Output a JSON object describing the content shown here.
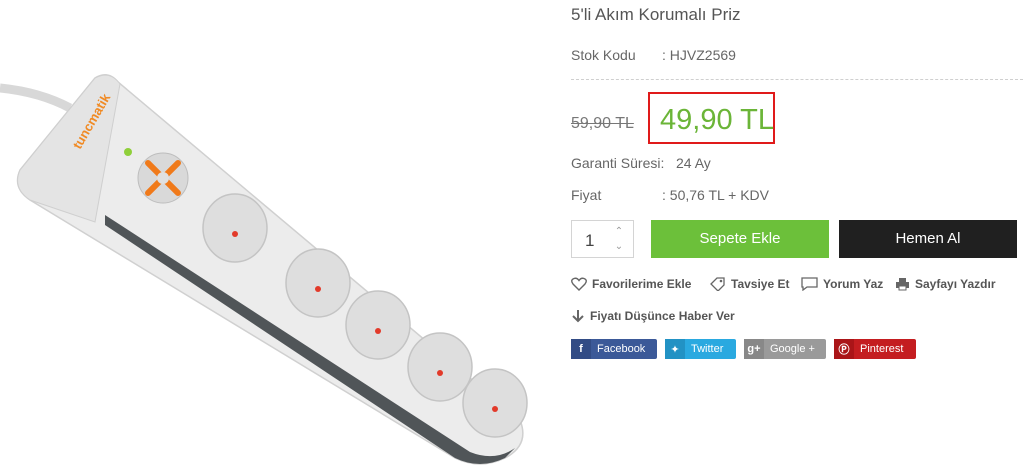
{
  "product": {
    "title": "5'li Akım Korumalı Priz",
    "brand_logo_text": "tuncmatik"
  },
  "details": {
    "sku_label": "Stok Kodu",
    "sku_value": ":  HJVZ2569",
    "warranty_label": "Garanti Süresi:",
    "warranty_value": "24 Ay",
    "price_label": "Fiyat",
    "price_value": ":  50,76 TL + KDV"
  },
  "pricing": {
    "old_price": "59,90 TL",
    "new_price": "49,90 TL",
    "new_price_color": "#6bb538",
    "highlight_color": "#e01a1a"
  },
  "purchase": {
    "quantity": "1",
    "add_to_cart_label": "Sepete Ekle",
    "buy_now_label": "Hemen Al",
    "cart_color": "#6cc03a",
    "buy_color": "#202020"
  },
  "actions": {
    "favorites": "Favorilerime Ekle",
    "recommend": "Tavsiye Et",
    "review": "Yorum Yaz",
    "print": "Sayfayı Yazdır",
    "price_alert": "Fiyatı Düşünce Haber Ver"
  },
  "share": {
    "facebook": "Facebook",
    "twitter": "Twitter",
    "google": "Google +",
    "pinterest": "Pinterest"
  },
  "icons": [
    "heart-icon",
    "tag-icon",
    "comment-icon",
    "printer-icon",
    "arrow-down-icon",
    "facebook-icon",
    "twitter-icon",
    "google-plus-icon",
    "pinterest-icon"
  ]
}
